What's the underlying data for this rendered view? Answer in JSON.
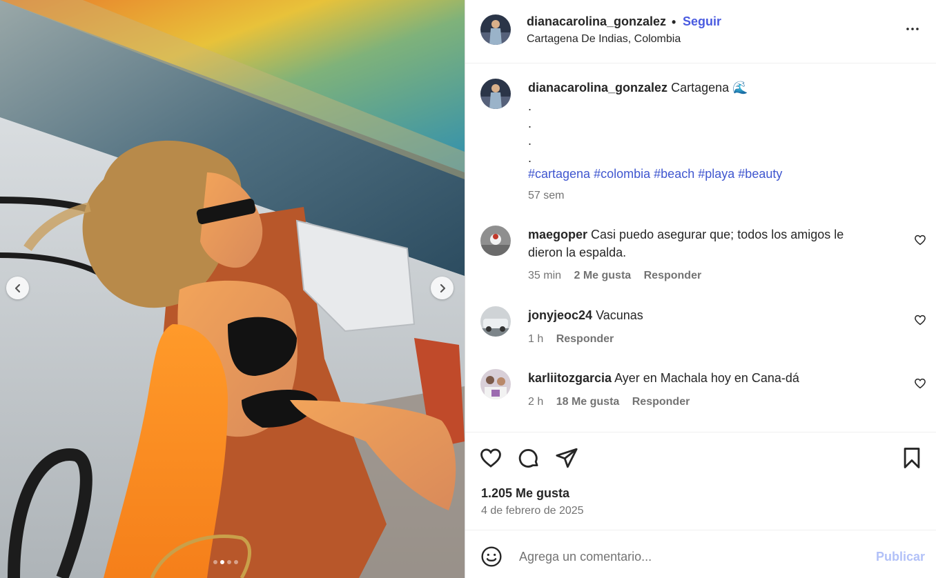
{
  "post": {
    "author": "dianacarolina_gonzalez",
    "follow_label": "Seguir",
    "separator": "•",
    "location": "Cartagena De Indias, Colombia",
    "more_icon": "more-horizontal-icon"
  },
  "media": {
    "slide_count": 4,
    "active_slide": 2,
    "prev_icon": "chevron-left-icon",
    "next_icon": "chevron-right-icon"
  },
  "caption": {
    "author": "dianacarolina_gonzalez",
    "text": "Cartagena",
    "emoji": "🌊",
    "dots": [
      ".",
      ".",
      ".",
      "."
    ],
    "hashtags": [
      "#cartagena",
      "#colombia",
      "#beach",
      "#playa",
      "#beauty"
    ],
    "time": "57 sem"
  },
  "comments": [
    {
      "user": "maegoper",
      "text": "Casi puedo asegurar que; todos los amigos le",
      "text_line2": "dieron la espalda.",
      "time": "35 min",
      "likes": "2 Me gusta",
      "reply": "Responder"
    },
    {
      "user": "jonyjeoc24",
      "text": "Vacunas",
      "time": "1 h",
      "likes": "",
      "reply": "Responder"
    },
    {
      "user": "karliitozgarcia",
      "text": "Ayer en Machala hoy en Cana-dá",
      "time": "2 h",
      "likes": "18 Me gusta",
      "reply": "Responder"
    }
  ],
  "actions": {
    "like_icon": "heart-icon",
    "comment_icon": "comment-icon",
    "share_icon": "send-icon",
    "save_icon": "bookmark-icon",
    "likes_count": "1.205 Me gusta",
    "date": "4 de febrero de 2025"
  },
  "composer": {
    "emoji_icon": "emoji-icon",
    "placeholder": "Agrega un comentario...",
    "publish_label": "Publicar"
  },
  "colors": {
    "link": "#4a5be0",
    "hashtag": "#3f56cf",
    "publish_disabled": "#b2c1f8",
    "muted": "#737373"
  }
}
